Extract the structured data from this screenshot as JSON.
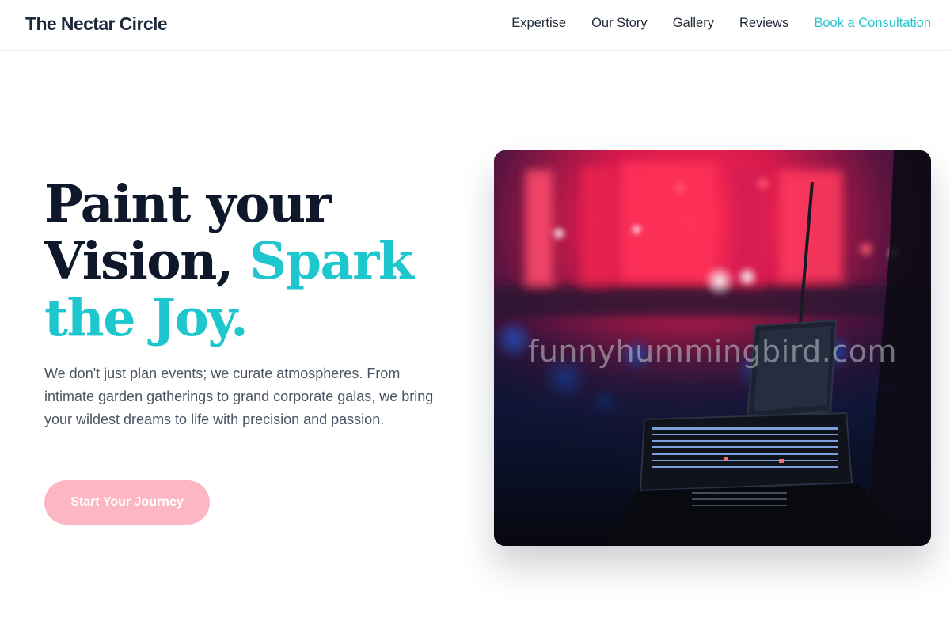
{
  "header": {
    "brand": "The Nectar Circle",
    "nav": [
      {
        "label": "Expertise"
      },
      {
        "label": "Our Story"
      },
      {
        "label": "Gallery"
      },
      {
        "label": "Reviews"
      },
      {
        "label": "Book a Consultation"
      }
    ]
  },
  "hero": {
    "headline_line1": "Paint your",
    "headline_line2_start": "Vision, ",
    "headline_line2_accent": "Spark",
    "headline_line3_accent": "the Joy.",
    "description": "We don't just plan events; we curate atmospheres. From intimate garden gatherings to grand corporate galas, we bring your wildest dreams to life with precision and passion.",
    "cta_label": "Start Your Journey",
    "image_watermark": "funnyhummingbird.com"
  },
  "colors": {
    "accent_teal": "#1ec6cd",
    "cta_pink": "#fdb7c2",
    "heading_dark": "#0f172a"
  }
}
